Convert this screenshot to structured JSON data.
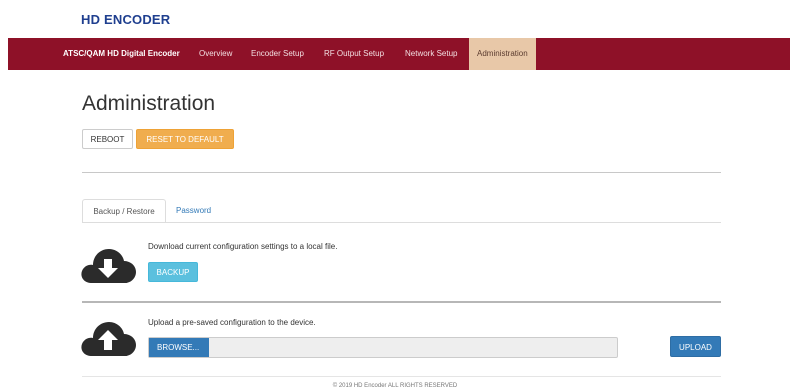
{
  "brand": "HD ENCODER",
  "nav": {
    "title": "ATSC/QAM HD Digital Encoder",
    "items": [
      "Overview",
      "Encoder Setup",
      "RF Output Setup",
      "Network Setup",
      "Administration"
    ],
    "active": "Administration"
  },
  "page": {
    "title": "Administration",
    "reboot_label": "REBOOT",
    "reset_label": "RESET TO DEFAULT"
  },
  "tabs": [
    "Backup / Restore",
    "Password"
  ],
  "backup": {
    "description": "Download current configuration settings to a local file.",
    "button_label": "BACKUP",
    "icon": "cloud-download-icon"
  },
  "restore": {
    "description": "Upload a pre-saved configuration to the device.",
    "browse_label": "BROWSE...",
    "upload_label": "UPLOAD",
    "icon": "cloud-upload-icon"
  },
  "footer": "© 2019 HD Encoder ALL RIGHTS RESERVED",
  "colors": {
    "navbar": "#8e1128",
    "active_tab": "#e8c8a8",
    "warning": "#f0ad4e",
    "info": "#5bc0de",
    "primary": "#337ab7"
  }
}
